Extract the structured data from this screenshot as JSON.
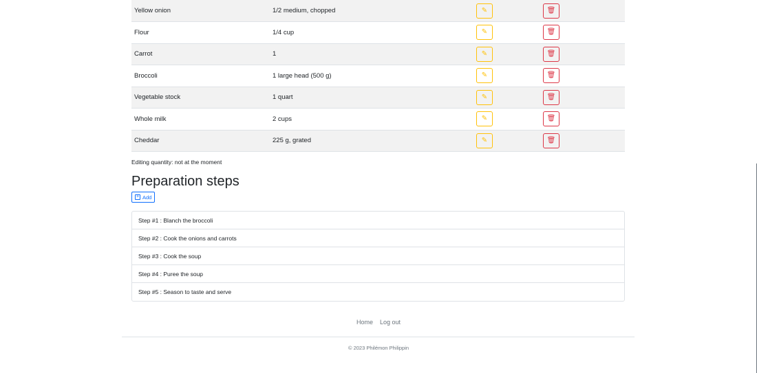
{
  "ingredients": [
    {
      "name": "Yellow onion",
      "quantity": "1/2 medium, chopped"
    },
    {
      "name": "Flour",
      "quantity": "1/4 cup"
    },
    {
      "name": "Carrot",
      "quantity": "1"
    },
    {
      "name": "Broccoli",
      "quantity": "1 large head (500 g)"
    },
    {
      "name": "Vegetable stock",
      "quantity": "1 quart"
    },
    {
      "name": "Whole milk",
      "quantity": "2 cups"
    },
    {
      "name": "Cheddar",
      "quantity": "225 g, grated"
    }
  ],
  "icons": {
    "edit": "pencil-icon",
    "delete": "trash-icon",
    "add": "plus-square-icon"
  },
  "status": {
    "editing_text": "Editing quantity: not at the moment"
  },
  "preparation": {
    "title": "Preparation steps",
    "add_label": "Add",
    "steps": [
      "Step #1 : Blanch the broccoli",
      "Step #2 : Cook the onions and carrots",
      "Step #3 : Cook the soup",
      "Step #4 : Puree the soup",
      "Step #5 : Season to taste and serve"
    ]
  },
  "footer": {
    "nav": {
      "home": "Home",
      "logout": "Log out"
    },
    "copyright": "© 2023 Philémon Philippin"
  },
  "colors": {
    "edit": "#ffc107",
    "delete": "#dc3545",
    "primary": "#0d6efd",
    "muted": "#6c757d",
    "stripe": "#f2f2f2"
  }
}
